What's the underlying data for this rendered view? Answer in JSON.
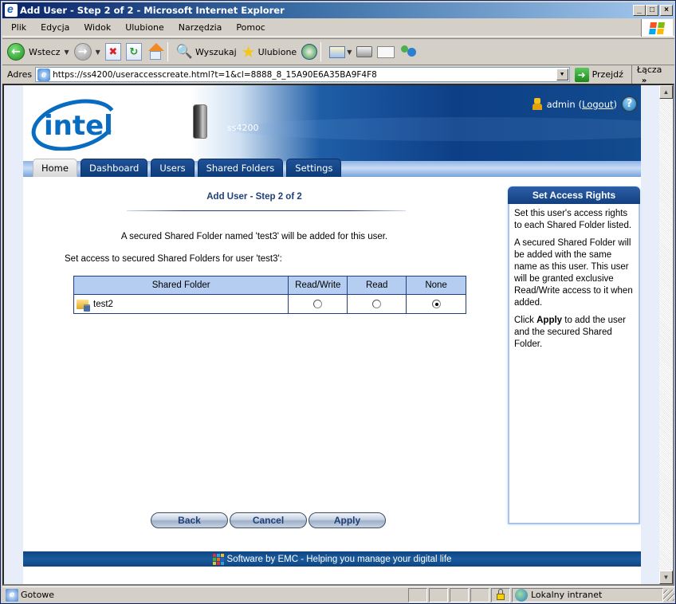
{
  "window": {
    "title": "Add User - Step 2 of 2 - Microsoft Internet Explorer",
    "controls": {
      "minimize": "_",
      "maximize": "□",
      "close": "×"
    }
  },
  "menu": [
    "Plik",
    "Edycja",
    "Widok",
    "Ulubione",
    "Narzędzia",
    "Pomoc"
  ],
  "toolbar": {
    "back_label": "Wstecz",
    "search_label": "Wyszukaj",
    "favorites_label": "Ulubione"
  },
  "address": {
    "label": "Adres",
    "url": "https://ss4200/useraccesscreate.html?t=1&cl=8888_8_15A90E6A35BA9F4F8",
    "go_label": "Przejdź",
    "links_label": "Łącza",
    "links_chevron": "»"
  },
  "header": {
    "brand": "intel",
    "device_name": "ss4200",
    "user": "admin",
    "logout_open": "(",
    "logout_label": "Logout",
    "logout_close": ")",
    "help": "?"
  },
  "tabs": [
    {
      "label": "Home",
      "active": true
    },
    {
      "label": "Dashboard",
      "active": false
    },
    {
      "label": "Users",
      "active": false
    },
    {
      "label": "Shared Folders",
      "active": false
    },
    {
      "label": "Settings",
      "active": false
    }
  ],
  "main": {
    "title": "Add User - Step 2 of 2",
    "notice": "A secured Shared Folder named 'test3' will be added for this user.",
    "instruction": "Set access to secured Shared Folders for user 'test3':",
    "table": {
      "headers": [
        "Shared Folder",
        "Read/Write",
        "Read",
        "None"
      ],
      "rows": [
        {
          "folder": "test2",
          "access": "None"
        }
      ]
    },
    "buttons": {
      "back": "Back",
      "cancel": "Cancel",
      "apply": "Apply"
    }
  },
  "sidepanel": {
    "title": "Set Access Rights",
    "p1": "Set this user's access rights to each Shared Folder listed.",
    "p2": "A secured Shared Folder will be added with the same name as this user. This user will be granted exclusive Read/Write access to it when added.",
    "p3_pre": "Click ",
    "p3_bold": "Apply",
    "p3_post": " to add the user and the secured Shared Folder."
  },
  "footer": {
    "text": "Software by EMC - Helping you manage your digital life",
    "logo_colors": [
      "#e03030",
      "#30a0e0",
      "#f0c020",
      "#40b040",
      "#e07020",
      "#3060c0",
      "#f0c020",
      "#e03030",
      "#30a0e0"
    ]
  },
  "status": {
    "text": "Gotowe",
    "zone": "Lokalny intranet"
  },
  "colors": {
    "accent": "#1f3f78",
    "table_header": "#b5cdf1",
    "footer_bg": "#0e4583"
  }
}
